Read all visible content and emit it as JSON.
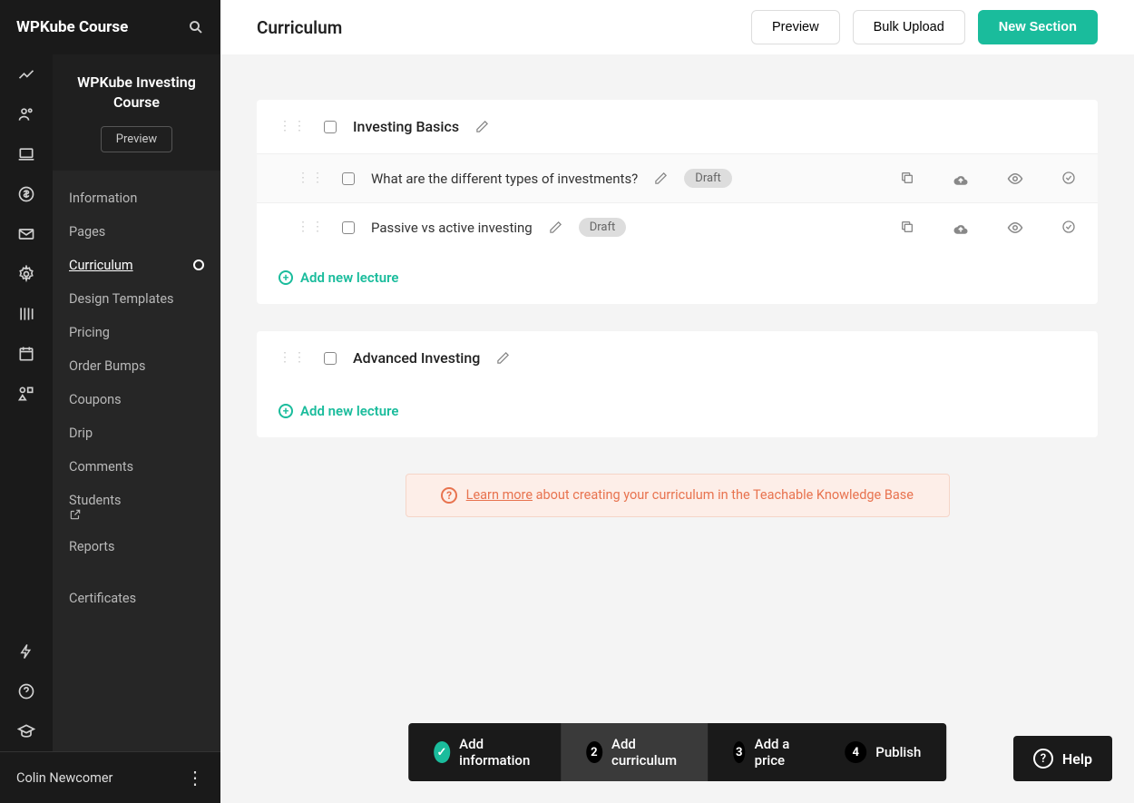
{
  "brand": "WPKube Course",
  "course": {
    "name": "WPKube Investing Course",
    "preview_btn": "Preview"
  },
  "side_menu": [
    {
      "label": "Information"
    },
    {
      "label": "Pages"
    },
    {
      "label": "Curriculum",
      "active": true,
      "has_circle": true
    },
    {
      "label": "Design Templates"
    },
    {
      "label": "Pricing"
    },
    {
      "label": "Order Bumps"
    },
    {
      "label": "Coupons"
    },
    {
      "label": "Drip"
    },
    {
      "label": "Comments"
    },
    {
      "label": "Students",
      "external": true
    },
    {
      "label": "Reports"
    },
    {
      "label": "Certificates"
    }
  ],
  "user": {
    "name": "Colin Newcomer"
  },
  "page": {
    "title": "Curriculum",
    "actions": {
      "preview": "Preview",
      "bulk": "Bulk Upload",
      "new_section": "New Section"
    }
  },
  "sections": [
    {
      "title": "Investing Basics",
      "lectures": [
        {
          "title": "What are the different types of investments?",
          "status": "Draft"
        },
        {
          "title": "Passive vs active investing",
          "status": "Draft"
        }
      ]
    },
    {
      "title": "Advanced Investing",
      "lectures": []
    }
  ],
  "add_lecture_label": "Add new lecture",
  "banner": {
    "link_text": "Learn more",
    "rest": " about creating your curriculum in the Teachable Knowledge Base"
  },
  "steps": [
    {
      "label": "Add information",
      "done": true
    },
    {
      "label": "Add curriculum",
      "num": "2",
      "active": true
    },
    {
      "label": "Add a price",
      "num": "3"
    },
    {
      "label": "Publish",
      "num": "4"
    }
  ],
  "help_label": "Help"
}
